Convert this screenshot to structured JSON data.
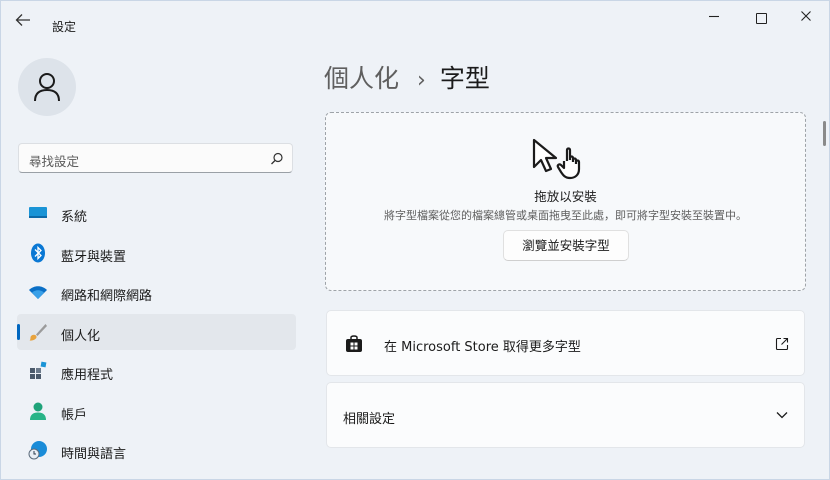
{
  "window": {
    "title": "設定",
    "controls": {
      "minimize": "—",
      "maximize": "□",
      "close": "✕"
    }
  },
  "sidebar": {
    "search_placeholder": "尋找設定",
    "items": [
      {
        "label": "系統",
        "icon": "system-monitor-icon",
        "selected": false
      },
      {
        "label": "藍牙與裝置",
        "icon": "bluetooth-icon",
        "selected": false
      },
      {
        "label": "網路和網際網路",
        "icon": "wifi-icon",
        "selected": false
      },
      {
        "label": "個人化",
        "icon": "brush-icon",
        "selected": true
      },
      {
        "label": "應用程式",
        "icon": "apps-icon",
        "selected": false
      },
      {
        "label": "帳戶",
        "icon": "account-icon",
        "selected": false
      },
      {
        "label": "時間與語言",
        "icon": "time-language-icon",
        "selected": false
      }
    ]
  },
  "breadcrumb": {
    "parent": "個人化",
    "separator": "›",
    "current": "字型"
  },
  "dropzone": {
    "title": "拖放以安裝",
    "description": "將字型檔案從您的檔案總管或桌面拖曳至此處，即可將字型安裝至裝置中。",
    "browse_label": "瀏覽並安裝字型"
  },
  "cards": {
    "store_label": "在 Microsoft Store 取得更多字型",
    "related_label": "相關設定"
  },
  "colors": {
    "accent": "#0067c0",
    "background": "#eef2f7"
  }
}
